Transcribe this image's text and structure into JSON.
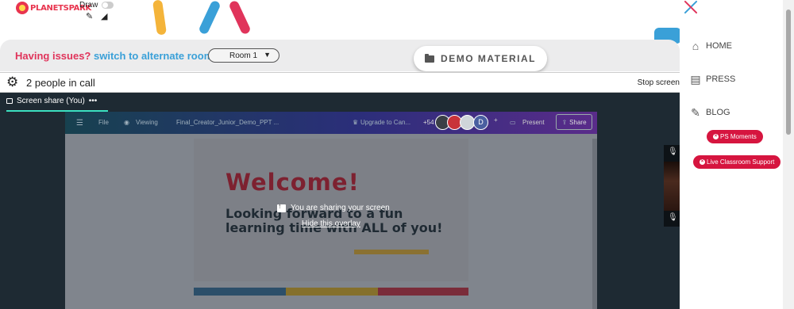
{
  "brand": {
    "name": "PLANETSPARK"
  },
  "draw": {
    "label": "Draw",
    "pencil_icon": "pencil-icon",
    "eraser_icon": "eraser-icon"
  },
  "issues": {
    "prefix": "Having issues?",
    "link": "switch to alternate room",
    "room_selected": "Room 1"
  },
  "demo_material": {
    "label": "DEMO MATERIAL",
    "icon": "folder-icon"
  },
  "call": {
    "people": "2 people in call",
    "stop_screen": "Stop screen"
  },
  "screen_share": {
    "tab_label": "Screen share (You)",
    "overlay_message": "You are sharing your screen",
    "overlay_link": "Hide this overlay"
  },
  "canva": {
    "file": "File",
    "viewing": "Viewing",
    "doc_title": "Final_Creator_Junior_Demo_PPT ...",
    "upgrade": "Upgrade to Can...",
    "collab_count": "+54",
    "present": "Present",
    "share": "Share",
    "avatar_letter": "D"
  },
  "slide": {
    "welcome": "Welcome!",
    "line1": "Looking forward to a fun",
    "line2": "learning time with ALL of you!"
  },
  "nav": {
    "items": [
      {
        "label": "HOME",
        "icon": "home-icon"
      },
      {
        "label": "PRESS",
        "icon": "press-icon"
      },
      {
        "label": "BLOG",
        "icon": "blog-icon"
      }
    ],
    "pills": [
      "PS Moments",
      "Live Classroom Support"
    ]
  },
  "colors": {
    "accent_pink": "#e0345b",
    "accent_blue": "#3aa0d8",
    "pill_red": "#d6153f",
    "share_tab": "#3be0c0"
  }
}
